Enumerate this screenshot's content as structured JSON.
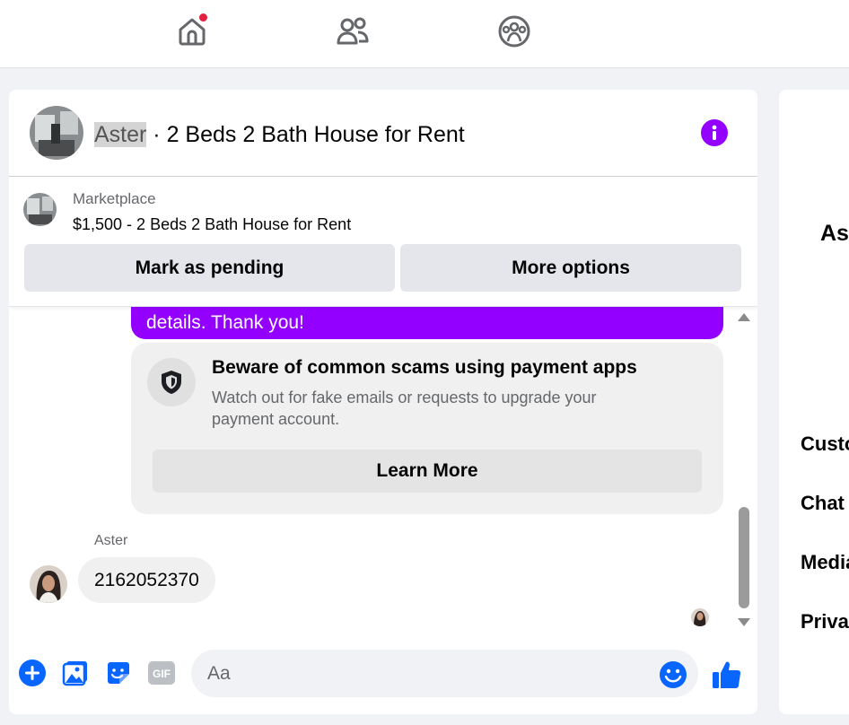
{
  "nav": {
    "items": [
      {
        "name": "home",
        "icon": "home-icon",
        "has_notification": true
      },
      {
        "name": "friends",
        "icon": "friends-icon"
      },
      {
        "name": "groups",
        "icon": "groups-icon"
      }
    ]
  },
  "chat": {
    "header": {
      "contact_name": "Aster",
      "separator": " · ",
      "listing_name": "2 Beds 2 Bath House for Rent"
    },
    "listing": {
      "source": "Marketplace",
      "title": "$1,500 - 2 Beds 2 Bath House for Rent",
      "mark_pending_label": "Mark as pending",
      "more_options_label": "More options"
    },
    "messages": {
      "sent_partial": "details. Thank you!",
      "warning": {
        "title": "Beware of common scams using payment apps",
        "body": "Watch out for fake emails or requests to upgrade your payment account.",
        "button_label": "Learn More"
      },
      "received": {
        "sender": "Aster",
        "text": "2162052370"
      }
    },
    "composer": {
      "placeholder": "Aa"
    }
  },
  "right_panel": {
    "name": "Aster",
    "items": [
      "Customize chat",
      "Chat members",
      "Media, files and links",
      "Privacy & support"
    ]
  },
  "colors": {
    "accent": "#9400ff",
    "facebook_blue": "#0866ff",
    "notification_red": "#e41e3f"
  }
}
